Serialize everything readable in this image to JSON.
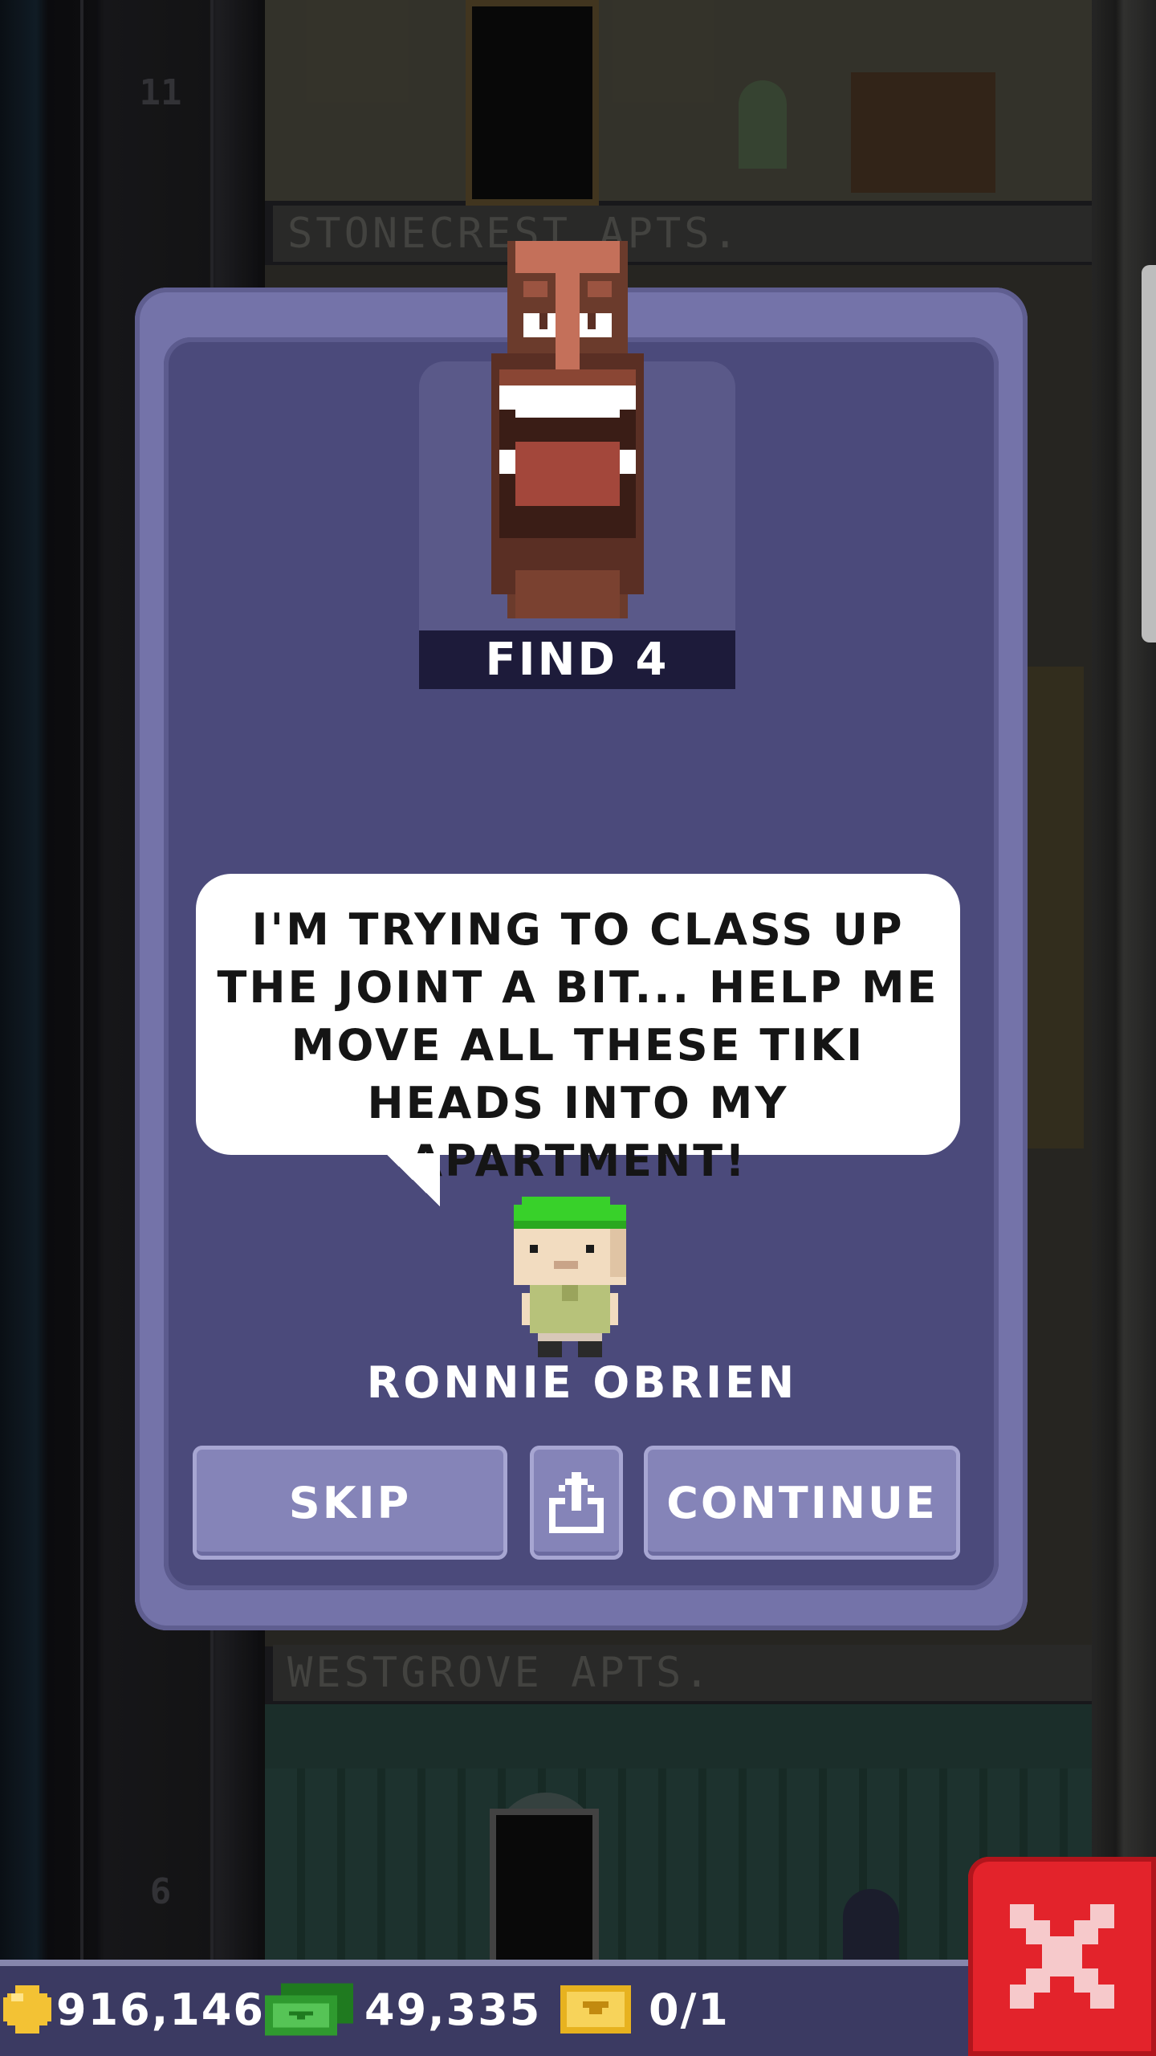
{
  "background": {
    "floor_numbers": [
      "11",
      "6"
    ],
    "floor_labels": [
      "STONECREST APTS.",
      "WESTGROVE APTS."
    ]
  },
  "mission": {
    "item_icon": "tiki-head-icon",
    "label": "FIND 4"
  },
  "dialogue": {
    "text": "I'M TRYING TO CLASS UP THE JOINT A BIT... HELP ME MOVE ALL THESE TIKI HEADS INTO MY APARTMENT!",
    "character_name": "RONNIE OBRIEN"
  },
  "buttons": {
    "skip": "SKIP",
    "share_icon": "share-icon",
    "continue": "CONTINUE"
  },
  "hud": {
    "coins": "916,146",
    "bux": "49,335",
    "tickets": "0/1"
  },
  "colors": {
    "dialog_frame": "#7473a9",
    "dialog_inner": "#4b4a7b",
    "button": "#8584b8",
    "close_button": "#e3232b",
    "coin": "#f3c234",
    "bux": "#2f9a2f"
  }
}
